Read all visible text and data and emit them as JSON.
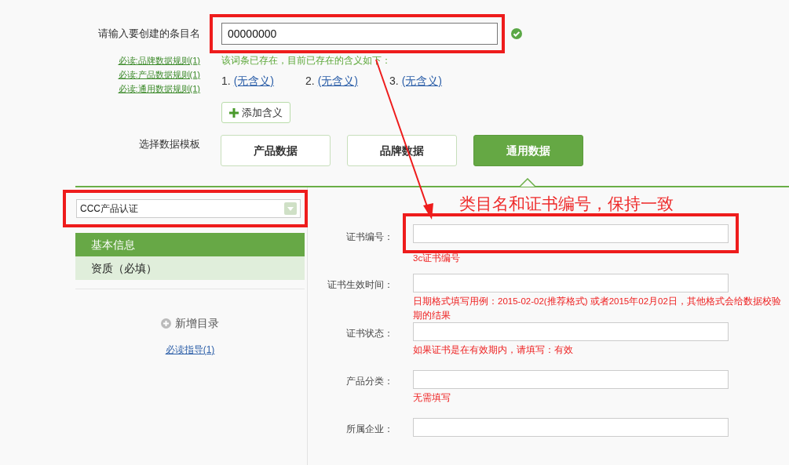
{
  "entry": {
    "label": "请输入要创建的条目名",
    "value": "00000000",
    "valid": true
  },
  "rule_links": [
    "必读:品牌数据规则(1)",
    "必读:产品数据规则(1)",
    "必读:通用数据规则(1)"
  ],
  "exists_notice": "该词条已存在，目前已存在的含义如下：",
  "meanings": [
    {
      "index": "1.",
      "text": "(无含义)"
    },
    {
      "index": "2.",
      "text": "(无含义)"
    },
    {
      "index": "3.",
      "text": "(无含义)"
    }
  ],
  "add_meaning_button": "添加含义",
  "template": {
    "label": "选择数据模板",
    "options": [
      {
        "label": "产品数据",
        "selected": false
      },
      {
        "label": "品牌数据",
        "selected": false
      },
      {
        "label": "通用数据",
        "selected": true
      }
    ]
  },
  "category_select": {
    "value": "CCC产品认证"
  },
  "sidebar": {
    "items": [
      {
        "label": "基本信息",
        "selected": true
      },
      {
        "label": "资质（必填）",
        "selected": false
      }
    ],
    "add_directory": "新增目录",
    "guide_link": "必读指导(1)"
  },
  "form_fields": [
    {
      "label": "证书编号：",
      "hint": [
        "3c证书编号"
      ]
    },
    {
      "label": "证书生效时间：",
      "hint": [
        "日期格式填写用例：2015-02-02(推荐格式) 或者2015年02月02日，其他格式会给数据校验",
        "期的结果"
      ]
    },
    {
      "label": "证书状态：",
      "hint": [
        "如果证书是在有效期内，请填写：有效"
      ]
    },
    {
      "label": "产品分类：",
      "hint": [
        "无需填写"
      ]
    },
    {
      "label": "所属企业："
    }
  ],
  "annotation": {
    "text": "类目名和证书编号，保持一致"
  }
}
